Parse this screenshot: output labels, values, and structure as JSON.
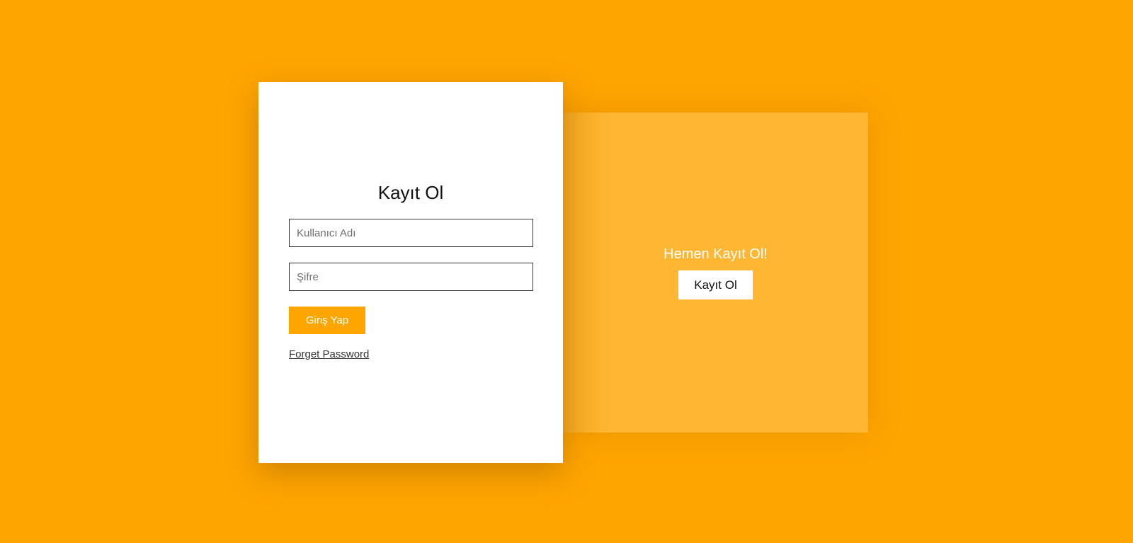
{
  "colors": {
    "background": "#ffa500",
    "panel": "#ffb733",
    "card": "#ffffff",
    "accent": "#ffa500"
  },
  "login": {
    "title": "Kayıt Ol",
    "username_placeholder": "Kullanıcı Adı",
    "password_placeholder": "Şifre",
    "submit_label": "Giriş Yap",
    "forget_label": "Forget Password"
  },
  "side": {
    "title": "Hemen Kayıt Ol!",
    "button_label": "Kayıt Ol"
  }
}
